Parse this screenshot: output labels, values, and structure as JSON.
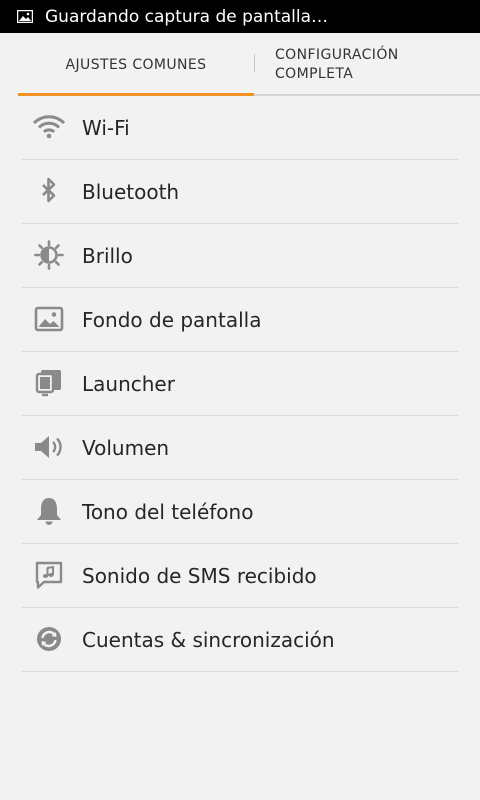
{
  "status_bar": {
    "icon": "image-icon",
    "text": "Guardando captura de pantalla…"
  },
  "tabs": [
    {
      "label": "AJUSTES COMUNES",
      "active": true
    },
    {
      "label_line1": "CONFIGURACIÓN",
      "label_line2": "COMPLETA",
      "active": false
    }
  ],
  "accent_color": "#f39224",
  "settings": [
    {
      "label": "Wi-Fi",
      "icon": "wifi-icon"
    },
    {
      "label": "Bluetooth",
      "icon": "bluetooth-icon"
    },
    {
      "label": "Brillo",
      "icon": "brightness-icon"
    },
    {
      "label": "Fondo de pantalla",
      "icon": "wallpaper-icon"
    },
    {
      "label": "Launcher",
      "icon": "launcher-icon"
    },
    {
      "label": "Volumen",
      "icon": "volume-icon"
    },
    {
      "label": "Tono del teléfono",
      "icon": "bell-icon"
    },
    {
      "label": "Sonido de SMS recibido",
      "icon": "sms-sound-icon"
    },
    {
      "label": "Cuentas & sincronización",
      "icon": "sync-icon"
    }
  ]
}
